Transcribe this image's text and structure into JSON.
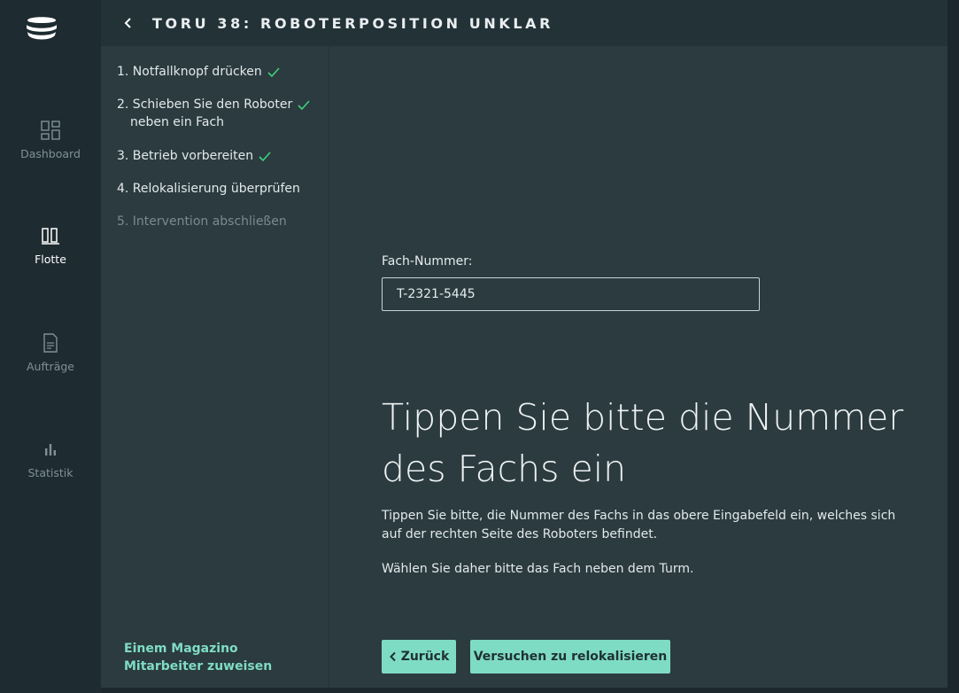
{
  "nav": {
    "items": [
      {
        "label": "Dashboard",
        "icon": "dashboard-icon"
      },
      {
        "label": "Flotte",
        "icon": "fleet-icon",
        "active": true
      },
      {
        "label": "Aufträge",
        "icon": "document-icon"
      },
      {
        "label": "Statistik",
        "icon": "bar-chart-icon"
      }
    ]
  },
  "header": {
    "title": "TORU 38: ROBOTERPOSITION UNKLAR"
  },
  "steps": {
    "items": [
      {
        "label": "1. Notfallknopf drücken",
        "done": true
      },
      {
        "label_line1": "2. Schieben Sie den Roboter",
        "label_line2": "neben ein Fach",
        "done": true
      },
      {
        "label": "3. Betrieb vorbereiten",
        "done": true
      },
      {
        "label": "4. Relokalisierung überprüfen",
        "done": false
      },
      {
        "label": "5. Intervention abschließen",
        "done": false
      }
    ],
    "assign_link": "Einem Magazino Mitarbeiter zuweisen"
  },
  "main": {
    "field_label": "Fach-Nummer:",
    "field_value": "T-2321-5445",
    "headline": "Tippen Sie bitte die Nummer des Fachs ein",
    "body1": "Tippen Sie bitte, die Nummer des Fachs in das obere Eingabefeld ein, welches sich auf der rechten Seite des Roboters befindet.",
    "body2": "Wählen Sie daher bitte das Fach neben dem Turm.",
    "back_button": "Zurück",
    "relocalize_button": "Versuchen zu relokalisieren"
  },
  "colors": {
    "accent": "#7fdcc4",
    "check": "#3ed17a",
    "panel": "#2b3b40",
    "rail": "#1e2b30"
  }
}
